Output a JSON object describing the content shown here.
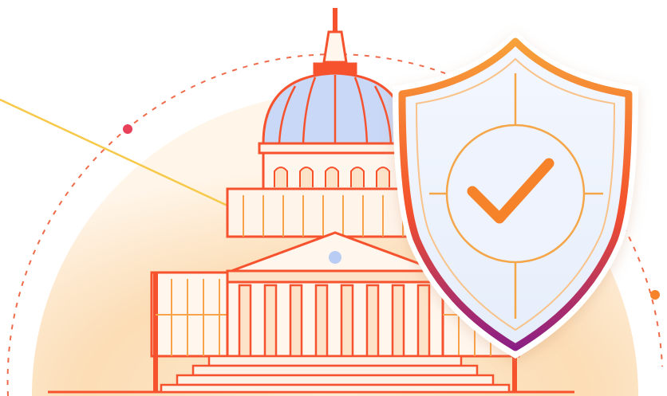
{
  "illustration": {
    "subject": "government-building-with-security-shield",
    "colors": {
      "orange": "#f6522e",
      "orange_light": "#f8a24a",
      "sun_glow": "#fbd9ad",
      "dome_blue": "#c9d8f7",
      "shield_fill": "#eef3fd",
      "shield_gradient_top": "#f7a13a",
      "shield_gradient_mid": "#f4512c",
      "shield_gradient_bottom": "#8b1f85",
      "check": "#f6822a",
      "yellow_line": "#f7c94a",
      "dot_red": "#e8415a"
    },
    "icons": [
      "dome-building-icon",
      "shield-check-icon"
    ]
  }
}
